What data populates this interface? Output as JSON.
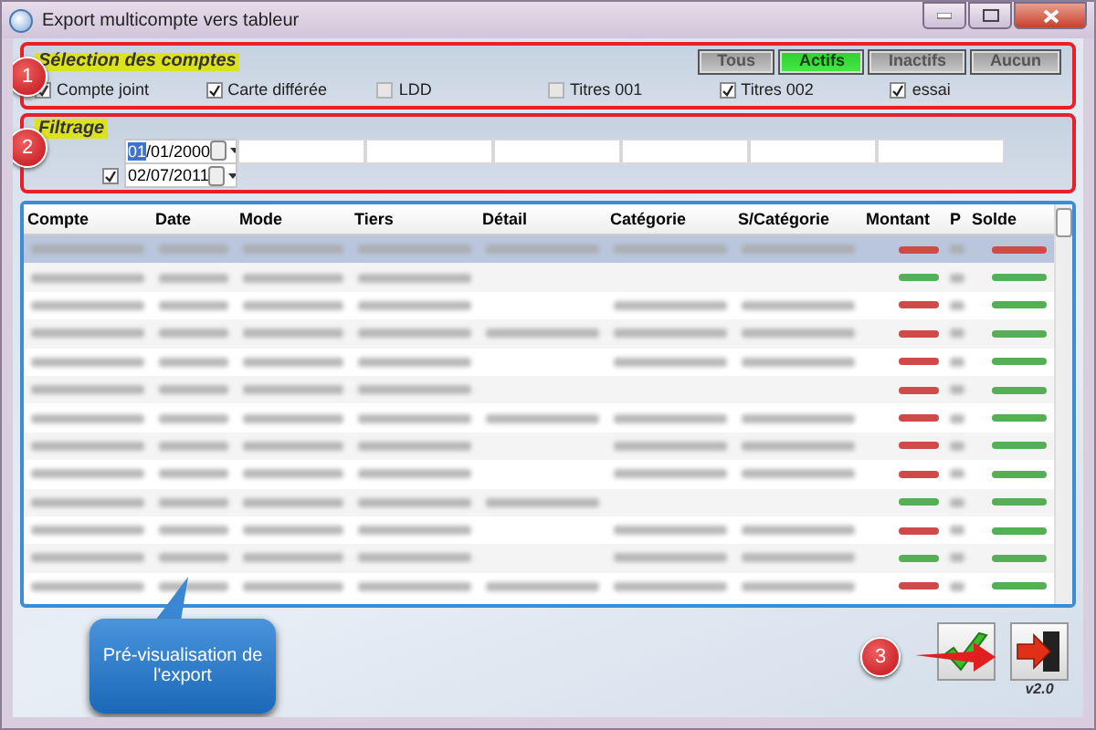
{
  "window": {
    "title": "Export multicompte vers tableur"
  },
  "accounts": {
    "title": "Sélection  des comptes",
    "marker": "1",
    "filters": [
      {
        "label": "Tous",
        "selected": false
      },
      {
        "label": "Actifs",
        "selected": true
      },
      {
        "label": "Inactifs",
        "selected": false
      },
      {
        "label": "Aucun",
        "selected": false
      }
    ],
    "items": [
      {
        "label": "Compte joint",
        "checked": true
      },
      {
        "label": "Carte différée",
        "checked": true
      },
      {
        "label": "LDD",
        "checked": false
      },
      {
        "label": "Titres 001",
        "checked": false
      },
      {
        "label": "Titres 002",
        "checked": true
      },
      {
        "label": "essai",
        "checked": true
      }
    ]
  },
  "filtering": {
    "title": "Filtrage",
    "marker": "2",
    "dates": [
      {
        "kind": "plain",
        "value_selected": "01",
        "value": "/01/2000"
      },
      {
        "kind": "checkbox",
        "checked": true,
        "value": "02/07/2011"
      }
    ]
  },
  "table": {
    "columns": [
      "Compte",
      "Date",
      "Mode",
      "Tiers",
      "Détail",
      "Catégorie",
      "S/Catégorie",
      "Montant",
      "P",
      "Solde"
    ],
    "rows": [
      {
        "selected": true,
        "amount": {
          "color": "#d04a4a"
        },
        "balance": {
          "color": "#d04a4a"
        }
      },
      {
        "selected": false,
        "amount": {
          "color": "#55b055"
        },
        "balance": {
          "color": "#55b055"
        }
      },
      {
        "selected": false,
        "amount": {
          "color": "#d04a4a"
        },
        "balance": {
          "color": "#55b055"
        }
      },
      {
        "selected": false,
        "amount": {
          "color": "#d04a4a"
        },
        "balance": {
          "color": "#55b055"
        }
      },
      {
        "selected": false,
        "amount": {
          "color": "#d04a4a"
        },
        "balance": {
          "color": "#55b055"
        }
      },
      {
        "selected": false,
        "amount": {
          "color": "#d04a4a"
        },
        "balance": {
          "color": "#55b055"
        }
      },
      {
        "selected": false,
        "amount": {
          "color": "#d04a4a"
        },
        "balance": {
          "color": "#55b055"
        }
      },
      {
        "selected": false,
        "amount": {
          "color": "#d04a4a"
        },
        "balance": {
          "color": "#55b055"
        }
      },
      {
        "selected": false,
        "amount": {
          "color": "#d04a4a"
        },
        "balance": {
          "color": "#55b055"
        }
      },
      {
        "selected": false,
        "amount": {
          "color": "#55b055"
        },
        "balance": {
          "color": "#55b055"
        }
      },
      {
        "selected": false,
        "amount": {
          "color": "#d04a4a"
        },
        "balance": {
          "color": "#55b055"
        }
      },
      {
        "selected": false,
        "amount": {
          "color": "#55b055"
        },
        "balance": {
          "color": "#55b055"
        }
      },
      {
        "selected": false,
        "amount": {
          "color": "#d04a4a"
        },
        "balance": {
          "color": "#55b055"
        }
      }
    ]
  },
  "callout": {
    "text": "Pré-visualisation de l'export"
  },
  "actions": {
    "marker": "3",
    "version": "v2.0"
  }
}
